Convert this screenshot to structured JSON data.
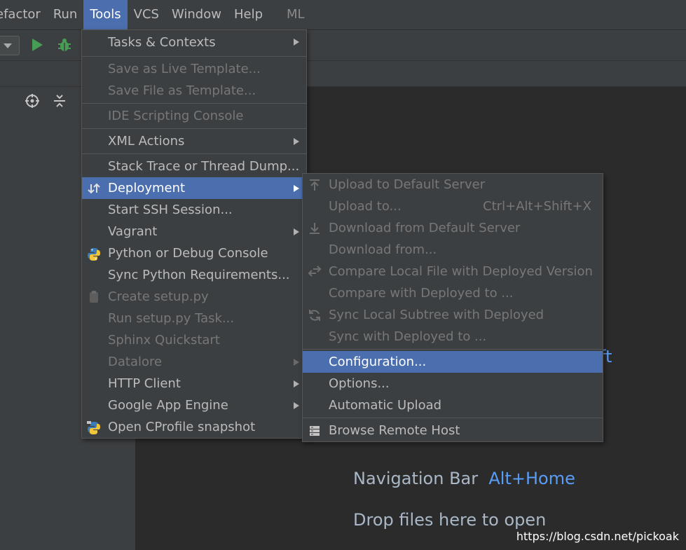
{
  "menubar": {
    "items": [
      "efactor",
      "Run",
      "Tools",
      "VCS",
      "Window",
      "Help"
    ],
    "extra": "ML"
  },
  "tools_menu": {
    "items": [
      {
        "label": "Tasks & Contexts",
        "submenu": true,
        "disabled": false
      },
      {
        "label": "Save as Live Template...",
        "submenu": false,
        "disabled": true
      },
      {
        "label": "Save File as Template...",
        "submenu": false,
        "disabled": true
      },
      {
        "label": "IDE Scripting Console",
        "submenu": false,
        "disabled": true
      },
      {
        "label": "XML Actions",
        "submenu": true,
        "disabled": false
      },
      {
        "label": "Stack Trace or Thread Dump...",
        "submenu": false,
        "disabled": false
      },
      {
        "label": "Deployment",
        "submenu": true,
        "disabled": false,
        "selected": true,
        "icon": "deployment-icon"
      },
      {
        "label": "Start SSH Session...",
        "submenu": false,
        "disabled": false
      },
      {
        "label": "Vagrant",
        "submenu": true,
        "disabled": false
      },
      {
        "label": "Python or Debug Console",
        "submenu": false,
        "disabled": false,
        "icon": "python-icon"
      },
      {
        "label": "Sync Python Requirements...",
        "submenu": false,
        "disabled": false
      },
      {
        "label": "Create setup.py",
        "submenu": false,
        "disabled": true,
        "icon": "setup-py-icon"
      },
      {
        "label": "Run setup.py Task...",
        "submenu": false,
        "disabled": true
      },
      {
        "label": "Sphinx Quickstart",
        "submenu": false,
        "disabled": true
      },
      {
        "label": "Datalore",
        "submenu": true,
        "disabled": true
      },
      {
        "label": "HTTP Client",
        "submenu": true,
        "disabled": false
      },
      {
        "label": "Google App Engine",
        "submenu": true,
        "disabled": false
      },
      {
        "label": "Open CProfile snapshot",
        "submenu": false,
        "disabled": false,
        "icon": "cprofile-icon"
      }
    ]
  },
  "deployment_menu": {
    "items": [
      {
        "label": "Upload to Default Server",
        "disabled": true,
        "icon": "upload-icon"
      },
      {
        "label": "Upload to...",
        "disabled": true,
        "shortcut": "Ctrl+Alt+Shift+X"
      },
      {
        "label": "Download from Default Server",
        "disabled": true,
        "icon": "download-icon"
      },
      {
        "label": "Download from...",
        "disabled": true
      },
      {
        "label": "Compare Local File with Deployed Version",
        "disabled": true,
        "icon": "compare-icon"
      },
      {
        "label": "Compare with Deployed to ...",
        "disabled": true
      },
      {
        "label": "Sync Local Subtree with Deployed",
        "disabled": true,
        "icon": "sync-icon"
      },
      {
        "label": "Sync with Deployed to ...",
        "disabled": true
      },
      {
        "label": "Configuration...",
        "disabled": false,
        "selected": true
      },
      {
        "label": "Options...",
        "disabled": false
      },
      {
        "label": "Automatic Upload",
        "disabled": false
      },
      {
        "label": "Browse Remote Host",
        "disabled": false,
        "icon": "server-icon"
      }
    ]
  },
  "editor": {
    "partial_text": "ft",
    "nav_bar_label": "Navigation Bar",
    "nav_bar_key": "Alt+Home",
    "drop_files": "Drop files here to open"
  },
  "watermark": "https://blog.csdn.net/pickoak",
  "colors": {
    "accent": "#4b6eaf",
    "background": "#3c3f41",
    "editor_bg": "#2b2b2b",
    "key_blue": "#589df6",
    "run_green": "#499c54"
  }
}
